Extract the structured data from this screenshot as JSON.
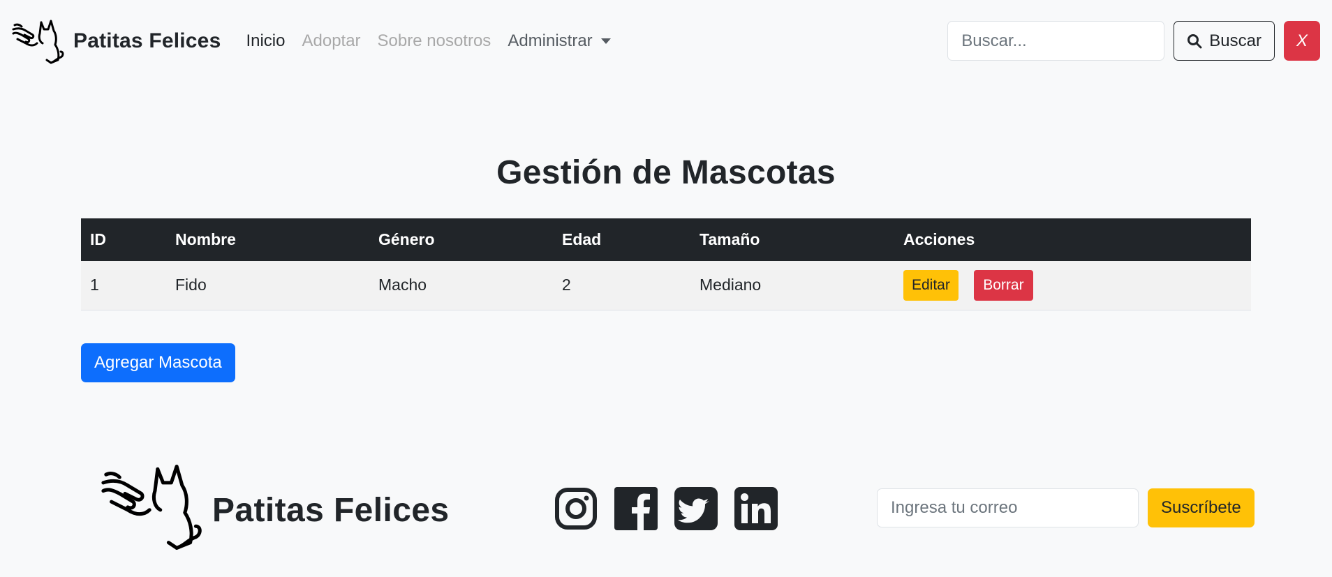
{
  "navbar": {
    "brand_name": "Patitas Felices",
    "links": [
      {
        "label": "Inicio",
        "state": "active"
      },
      {
        "label": "Adoptar",
        "state": "disabled"
      },
      {
        "label": "Sobre nosotros",
        "state": "disabled"
      },
      {
        "label": "Administrar",
        "state": "dropdown"
      }
    ],
    "search_placeholder": "Buscar...",
    "search_button_label": "Buscar",
    "close_button_label": "X"
  },
  "main": {
    "title": "Gestión de Mascotas",
    "table": {
      "headers": [
        "ID",
        "Nombre",
        "Género",
        "Edad",
        "Tamaño",
        "Acciones"
      ],
      "rows": [
        {
          "id": "1",
          "nombre": "Fido",
          "genero": "Macho",
          "edad": "2",
          "tamano": "Mediano",
          "edit_label": "Editar",
          "delete_label": "Borrar"
        }
      ]
    },
    "add_button_label": "Agregar Mascota"
  },
  "footer": {
    "brand_name": "Patitas Felices",
    "socials": [
      "instagram-icon",
      "facebook-icon",
      "twitter-icon",
      "linkedin-icon"
    ],
    "email_placeholder": "Ingresa tu correo",
    "subscribe_label": "Suscríbete"
  },
  "colors": {
    "primary": "#0d6efd",
    "warning": "#ffc107",
    "danger": "#dc3545",
    "dark": "#212529",
    "background": "#f8f9fa"
  }
}
